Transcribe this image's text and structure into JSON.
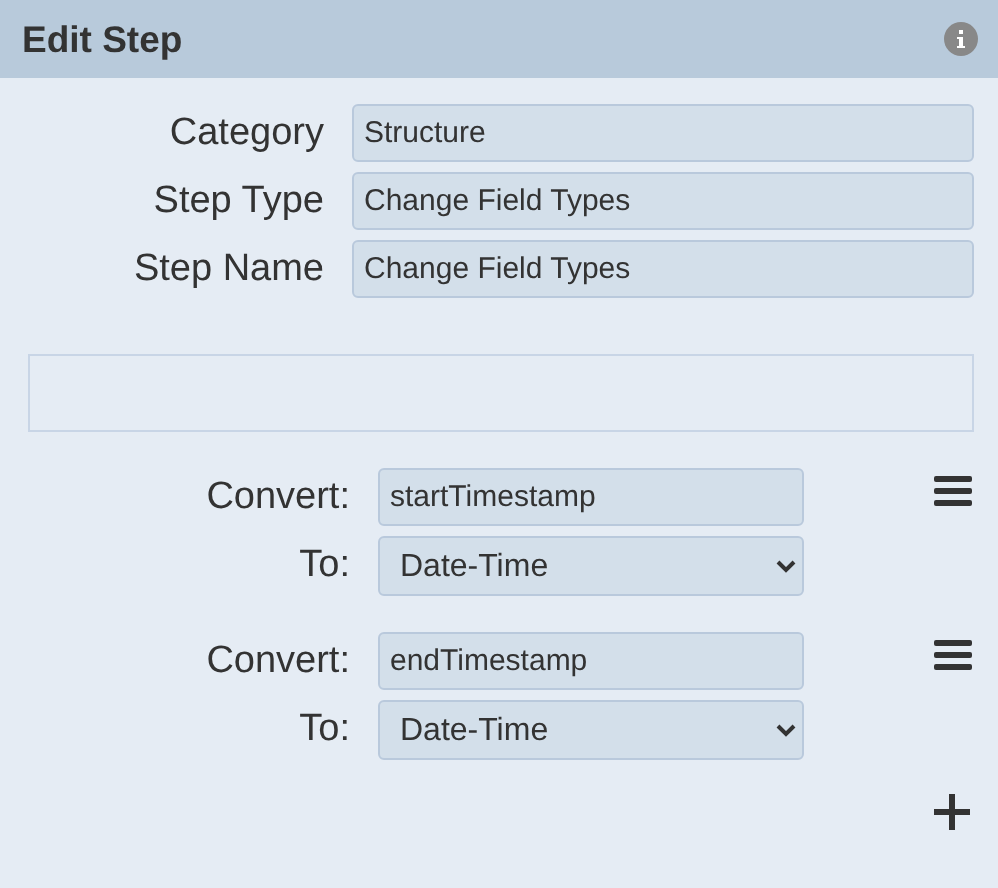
{
  "header": {
    "title": "Edit Step"
  },
  "fields": [
    {
      "label": "Category",
      "value": "Structure"
    },
    {
      "label": "Step Type",
      "value": "Change Field Types"
    },
    {
      "label": "Step Name",
      "value": "Change Field Types"
    }
  ],
  "conversions": [
    {
      "convert_label": "Convert:",
      "field": "startTimestamp",
      "to_label": "To:",
      "type": "Date-Time"
    },
    {
      "convert_label": "Convert:",
      "field": "endTimestamp",
      "to_label": "To:",
      "type": "Date-Time"
    }
  ]
}
